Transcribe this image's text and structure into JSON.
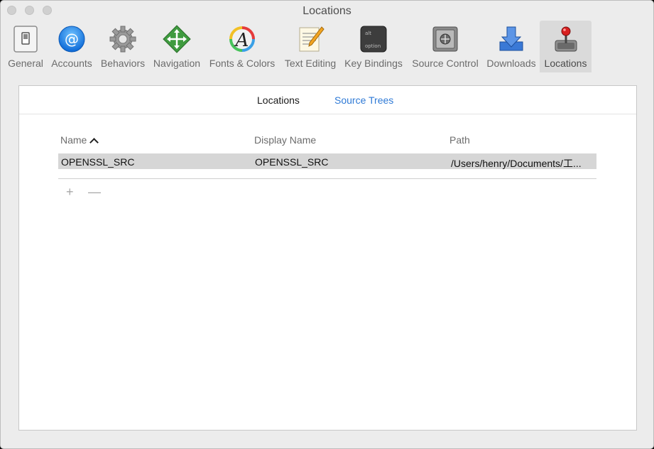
{
  "window": {
    "title": "Locations"
  },
  "toolbar": {
    "items": [
      {
        "label": "General",
        "icon": "switch-icon"
      },
      {
        "label": "Accounts",
        "icon": "at-sign-icon"
      },
      {
        "label": "Behaviors",
        "icon": "gear-icon"
      },
      {
        "label": "Navigation",
        "icon": "navigation-arrows-icon"
      },
      {
        "label": "Fonts & Colors",
        "icon": "font-colors-icon"
      },
      {
        "label": "Text Editing",
        "icon": "notepad-pencil-icon"
      },
      {
        "label": "Key Bindings",
        "icon": "keyboard-keys-icon"
      },
      {
        "label": "Source Control",
        "icon": "safe-icon"
      },
      {
        "label": "Downloads",
        "icon": "download-arrow-icon"
      },
      {
        "label": "Locations",
        "icon": "joystick-icon"
      }
    ],
    "selected": "Locations"
  },
  "segmented": {
    "tabs": [
      "Locations",
      "Source Trees"
    ],
    "active": "Locations"
  },
  "table": {
    "columns": [
      "Name",
      "Display Name",
      "Path"
    ],
    "sorted_by": "Name",
    "rows": [
      {
        "name": "OPENSSL_SRC",
        "display_name": "OPENSSL_SRC",
        "path": "/Users/henry/Documents/工..."
      }
    ]
  },
  "controls": {
    "add": "+",
    "remove": "—"
  },
  "colors": {
    "link": "#2f7ad6",
    "selected_row": "#d6d6d6"
  }
}
